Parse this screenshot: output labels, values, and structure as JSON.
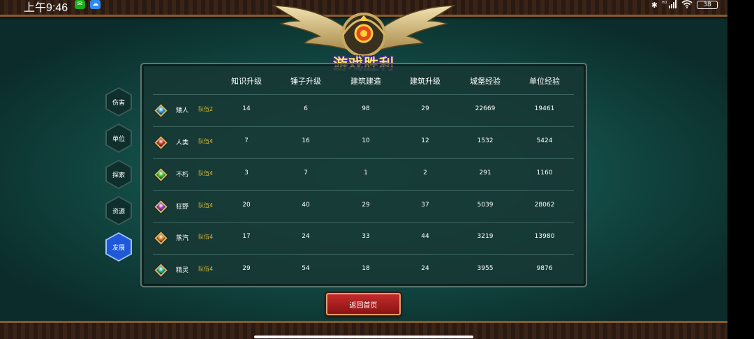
{
  "status_bar": {
    "time": "上午9:46",
    "battery": "38",
    "signal_text": "HD"
  },
  "header": {
    "title": "游戏胜利"
  },
  "side_tabs": [
    {
      "label": "伤害",
      "active": false
    },
    {
      "label": "单位",
      "active": false
    },
    {
      "label": "探索",
      "active": false
    },
    {
      "label": "资源",
      "active": false
    },
    {
      "label": "发展",
      "active": true
    }
  ],
  "table": {
    "columns": [
      "知识升级",
      "锤子升级",
      "建筑建造",
      "建筑升级",
      "城堡经验",
      "单位经验"
    ],
    "rows": [
      {
        "race": "矮人",
        "team": "队伍2",
        "gem_color": "#2aa6e0",
        "values": [
          "14",
          "6",
          "98",
          "29",
          "22669",
          "19461"
        ]
      },
      {
        "race": "人类",
        "team": "队伍4",
        "gem_color": "#d83030",
        "values": [
          "7",
          "16",
          "10",
          "12",
          "1532",
          "5424"
        ]
      },
      {
        "race": "不朽",
        "team": "队伍4",
        "gem_color": "#3ac83a",
        "values": [
          "3",
          "7",
          "1",
          "2",
          "291",
          "1160"
        ]
      },
      {
        "race": "狂野",
        "team": "队伍4",
        "gem_color": "#a040d0",
        "values": [
          "20",
          "40",
          "29",
          "37",
          "5039",
          "28062"
        ]
      },
      {
        "race": "蒸汽",
        "team": "队伍4",
        "gem_color": "#e0781e",
        "values": [
          "17",
          "24",
          "33",
          "44",
          "3219",
          "13980"
        ]
      },
      {
        "race": "精灵",
        "team": "队伍4",
        "gem_color": "#20b0a0",
        "values": [
          "29",
          "54",
          "18",
          "24",
          "3955",
          "9876"
        ]
      }
    ]
  },
  "footer": {
    "return_label": "返回首页"
  },
  "colors": {
    "accent_gold": "#e0c03c",
    "active_tab": "#1f58d8",
    "button_red": "#c42a2a"
  }
}
